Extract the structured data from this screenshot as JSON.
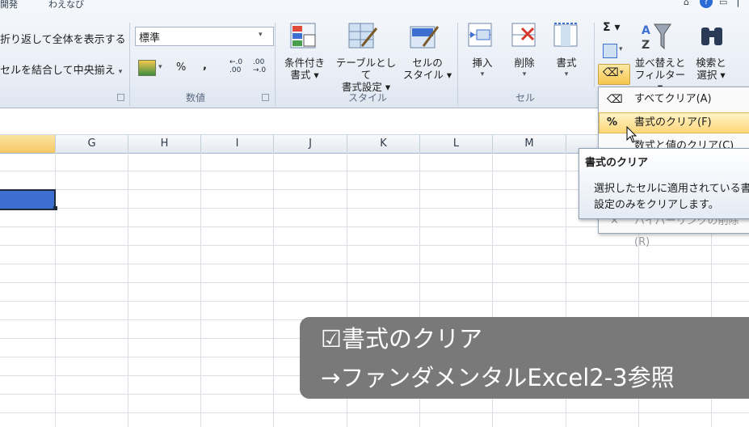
{
  "tabs": {
    "dev": "開発",
    "addin": "わえなび"
  },
  "alignment": {
    "wrap_text": "折り返して全体を表示する",
    "merge_center": "セルを結合して中央揃え"
  },
  "number": {
    "format_value": "標準",
    "percent": "%",
    "comma": ",",
    "inc_decimal": "←.0\n.00",
    "dec_decimal": ".00\n→.0",
    "group_label": "数値"
  },
  "styles": {
    "conditional": [
      "条件付き",
      "書式 ▾"
    ],
    "as_table": [
      "テーブルとして",
      "書式設定 ▾"
    ],
    "cell_styles": [
      "セルの",
      "スタイル ▾"
    ],
    "group_label": "スタイル"
  },
  "cells": {
    "insert": "挿入",
    "delete": "削除",
    "format": "書式",
    "group_label": "セル"
  },
  "editing": {
    "sigma": "Σ ▾",
    "sort_filter": [
      "並べ替えと",
      "フィルター ▾"
    ],
    "find_select": [
      "検索と",
      "選択 ▾"
    ]
  },
  "columns": [
    "G",
    "H",
    "I",
    "J",
    "K",
    "L",
    "M"
  ],
  "clear_menu": {
    "items": [
      {
        "label": "すべてクリア(A)",
        "icon": "eraser-icon"
      },
      {
        "label": "書式のクリア(F)",
        "icon": "clear-format-icon"
      },
      {
        "label": "数式と値のクリア(C)",
        "icon": "clear-contents-icon"
      },
      {
        "label": "ハイパーリンクの削除(R)",
        "icon": "remove-hyperlink-icon"
      }
    ]
  },
  "tooltip": {
    "title": "書式のクリア",
    "line1": "選択したセルに適用されている書",
    "line2": "設定のみをクリアします。"
  },
  "caption": {
    "line1": "☑書式のクリア",
    "line2": "→ファンダメンタルExcel2-3参照"
  },
  "colors": {
    "accent": "#3d6fd1",
    "menu_highlight": "#fde9a6",
    "caption_bg": "#6e6e6e"
  }
}
